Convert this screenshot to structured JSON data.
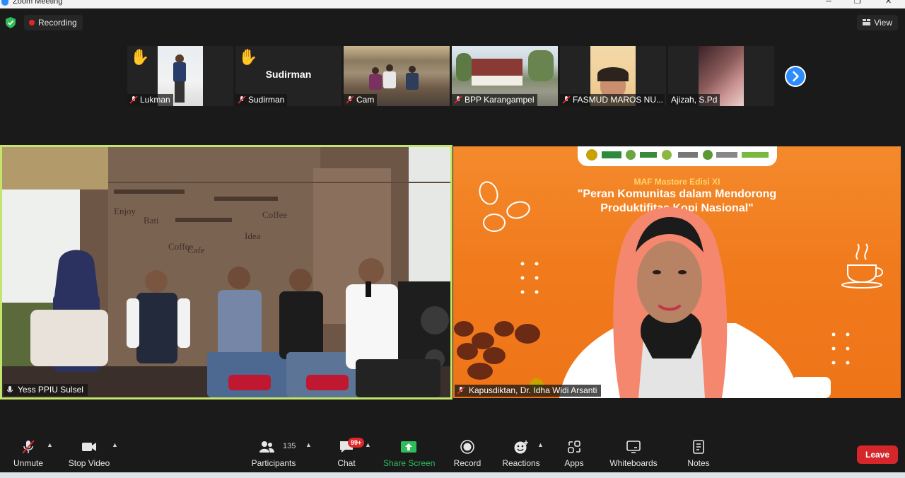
{
  "window": {
    "title": "Zoom Meeting"
  },
  "topbar": {
    "recording_label": "Recording",
    "view_label": "View"
  },
  "thumbnails": [
    {
      "name": "Lukman",
      "hand_raised": true
    },
    {
      "name": "Sudirman",
      "hand_raised": true,
      "display_name": "Sudirman"
    },
    {
      "name": "Cam",
      "hand_raised": false
    },
    {
      "name": "BPP Karangampel",
      "hand_raised": false
    },
    {
      "name": "FASMUD MAROS NU...",
      "hand_raised": false
    },
    {
      "name": "Ajizah, S.Pd",
      "hand_raised": false
    }
  ],
  "main_videos": {
    "left": {
      "name": "Yess PPIU Sulsel"
    },
    "right": {
      "name": "Kapusdiktan, Dr. Idha Widi Arsanti",
      "banner_subtitle": "MAF Mastore Edisi XI",
      "banner_title_line1": "\"Peran Komunitas dalam Mendorong",
      "banner_title_line2": "Produktifitas Kopi Nasional\""
    }
  },
  "toolbar": {
    "unmute": "Unmute",
    "stop_video": "Stop Video",
    "participants": "Participants",
    "participants_count": "135",
    "chat": "Chat",
    "chat_badge": "99+",
    "share_screen": "Share Screen",
    "record": "Record",
    "reactions": "Reactions",
    "apps": "Apps",
    "whiteboards": "Whiteboards",
    "notes": "Notes",
    "leave": "Leave"
  },
  "colors": {
    "accent_blue": "#2d8cff",
    "share_green": "#2ebd59",
    "leave_red": "#d4262b",
    "active_speaker": "#c3e56b"
  }
}
